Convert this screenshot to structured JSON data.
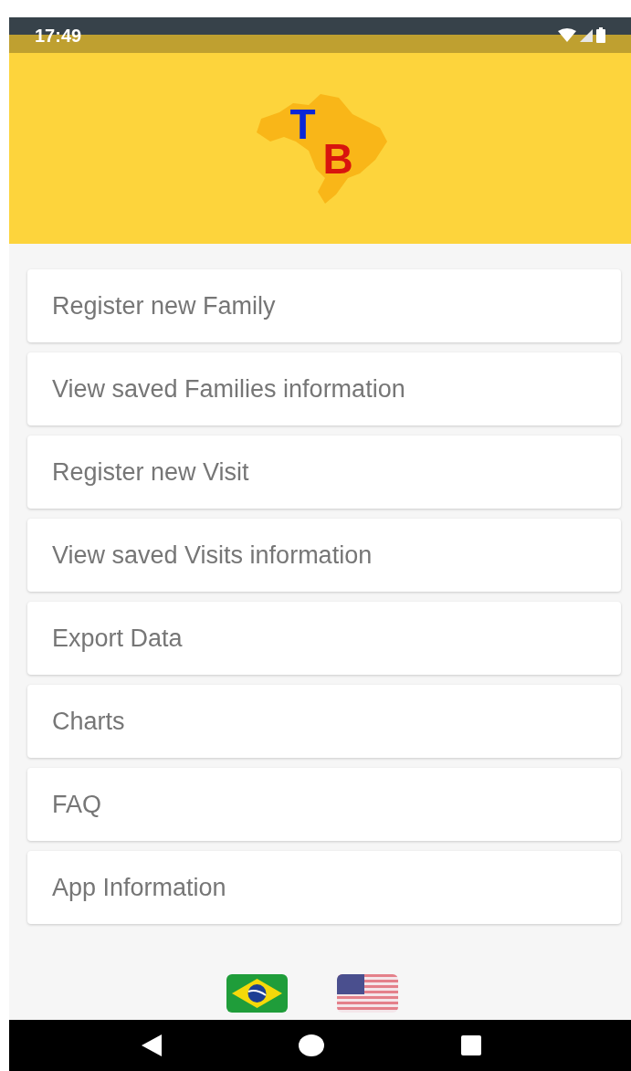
{
  "status_bar": {
    "time": "17:49"
  },
  "header": {
    "logo_letters": [
      "T",
      "B"
    ]
  },
  "menu": [
    {
      "label": "Register new Family"
    },
    {
      "label": "View saved Families information"
    },
    {
      "label": "Register new Visit"
    },
    {
      "label": "View saved Visits information"
    },
    {
      "label": "Export Data"
    },
    {
      "label": "Charts"
    },
    {
      "label": "FAQ"
    },
    {
      "label": "App Information"
    }
  ],
  "languages": [
    {
      "kind": "brazil"
    },
    {
      "kind": "usa"
    }
  ]
}
